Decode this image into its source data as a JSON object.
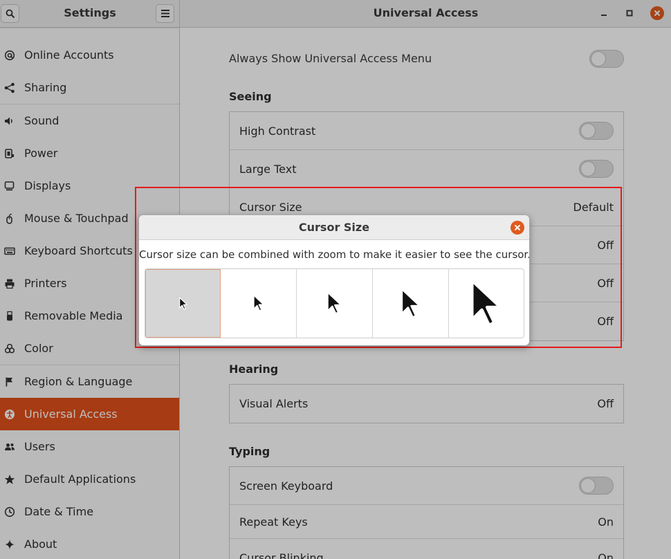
{
  "window": {
    "sidebar_title": "Settings",
    "main_title": "Universal Access"
  },
  "sidebar": {
    "items": [
      {
        "label": "Online Accounts",
        "icon": "at-icon"
      },
      {
        "label": "Sharing",
        "icon": "share-icon"
      },
      {
        "label": "Sound",
        "icon": "speaker-icon"
      },
      {
        "label": "Power",
        "icon": "power-icon"
      },
      {
        "label": "Displays",
        "icon": "display-icon"
      },
      {
        "label": "Mouse & Touchpad",
        "icon": "mouse-icon"
      },
      {
        "label": "Keyboard Shortcuts",
        "icon": "keyboard-icon"
      },
      {
        "label": "Printers",
        "icon": "printer-icon"
      },
      {
        "label": "Removable Media",
        "icon": "usb-icon"
      },
      {
        "label": "Color",
        "icon": "color-icon"
      },
      {
        "label": "Region & Language",
        "icon": "flag-icon"
      },
      {
        "label": "Universal Access",
        "icon": "accessibility-icon"
      },
      {
        "label": "Users",
        "icon": "users-icon"
      },
      {
        "label": "Default Applications",
        "icon": "star-icon"
      },
      {
        "label": "Date & Time",
        "icon": "clock-icon"
      },
      {
        "label": "About",
        "icon": "sparkle-icon"
      }
    ],
    "active": "Universal Access"
  },
  "main": {
    "always_show_label": "Always Show Universal Access Menu",
    "always_show_on": false,
    "seeing": {
      "title": "Seeing",
      "rows": [
        {
          "label": "High Contrast",
          "switch": false
        },
        {
          "label": "Large Text",
          "switch": false
        },
        {
          "label": "Cursor Size",
          "value": "Default"
        },
        {
          "label": "",
          "value": "Off"
        },
        {
          "label": "",
          "value": "Off"
        },
        {
          "label": "",
          "value": "Off"
        }
      ]
    },
    "hearing": {
      "title": "Hearing",
      "rows": [
        {
          "label": "Visual Alerts",
          "value": "Off"
        }
      ]
    },
    "typing": {
      "title": "Typing",
      "rows": [
        {
          "label": "Screen Keyboard",
          "switch": false
        },
        {
          "label": "Repeat Keys",
          "value": "On"
        },
        {
          "label": "Cursor Blinking",
          "value": "On"
        }
      ]
    }
  },
  "dialog": {
    "title": "Cursor Size",
    "description": "Cursor size can be combined with zoom to make it easier to see the cursor.",
    "options": [
      "cursor-size-1",
      "cursor-size-2",
      "cursor-size-3",
      "cursor-size-4",
      "cursor-size-5"
    ],
    "selected_index": 0
  },
  "colors": {
    "accent": "#e1501a",
    "highlight_box": "#e41b1b",
    "close_button": "#e05a1e"
  }
}
